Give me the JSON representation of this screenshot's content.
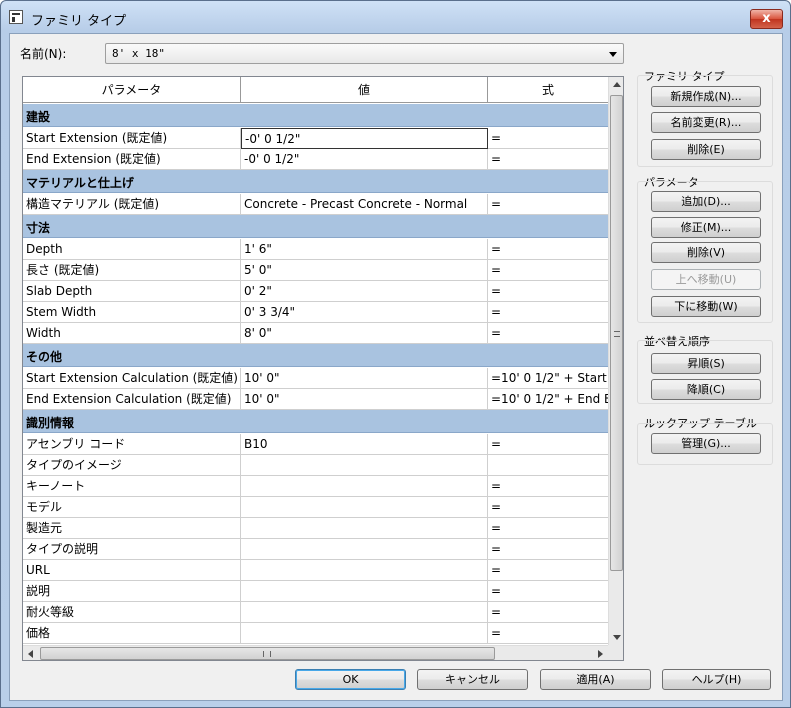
{
  "window": {
    "title": "ファミリ タイプ",
    "close_glyph": "x"
  },
  "name_field": {
    "label": "名前(N):",
    "value": "8' x 18\""
  },
  "grid": {
    "columns": [
      "パラメータ",
      "値",
      "式"
    ],
    "rows": [
      {
        "group": "建設"
      },
      {
        "param": "Start Extension (既定値)",
        "value": "-0'  0 1/2\"",
        "formula": "=",
        "active": true
      },
      {
        "param": "End Extension (既定値)",
        "value": "-0'  0 1/2\"",
        "formula": "="
      },
      {
        "group": "マテリアルと仕上げ"
      },
      {
        "param": "構造マテリアル (既定値)",
        "value": "Concrete - Precast Concrete - Normal",
        "formula": "="
      },
      {
        "group": "寸法"
      },
      {
        "param": "Depth",
        "value": "1'  6\"",
        "formula": "="
      },
      {
        "param": "長さ (既定値)",
        "value": "5'  0\"",
        "formula": "="
      },
      {
        "param": "Slab Depth",
        "value": "0'  2\"",
        "formula": "="
      },
      {
        "param": "Stem Width",
        "value": "0'  3 3/4\"",
        "formula": "="
      },
      {
        "param": "Width",
        "value": "8'  0\"",
        "formula": "="
      },
      {
        "group": "その他"
      },
      {
        "param": "Start Extension Calculation (既定値)",
        "value": "10'  0\"",
        "formula": "=10'  0 1/2\" + Start"
      },
      {
        "param": "End Extension Calculation (既定値)",
        "value": "10'  0\"",
        "formula": "=10'  0 1/2\" + End E"
      },
      {
        "group": "識別情報"
      },
      {
        "param": "アセンブリ コード",
        "value": "B10",
        "formula": "="
      },
      {
        "param": "タイプのイメージ",
        "value": "",
        "formula": ""
      },
      {
        "param": "キーノート",
        "value": "",
        "formula": "="
      },
      {
        "param": "モデル",
        "value": "",
        "formula": "="
      },
      {
        "param": "製造元",
        "value": "",
        "formula": "="
      },
      {
        "param": "タイプの説明",
        "value": "",
        "formula": "="
      },
      {
        "param": "URL",
        "value": "",
        "formula": "="
      },
      {
        "param": "説明",
        "value": "",
        "formula": "="
      },
      {
        "param": "耐火等級",
        "value": "",
        "formula": "="
      },
      {
        "param": "価格",
        "value": "",
        "formula": "="
      }
    ]
  },
  "family_types": {
    "title": "ファミリ タイプ",
    "new": "新規作成(N)...",
    "rename": "名前変更(R)...",
    "delete": "削除(E)"
  },
  "parameters": {
    "title": "パラメータ",
    "add": "追加(D)...",
    "modify": "修正(M)...",
    "remove": "削除(V)",
    "move_up": "上へ移動(U)",
    "move_down": "下に移動(W)"
  },
  "sort_order": {
    "title": "並べ替え順序",
    "ascending": "昇順(S)",
    "descending": "降順(C)"
  },
  "lookup_tables": {
    "title": "ルックアップ テーブル",
    "manage": "管理(G)..."
  },
  "footer": {
    "ok": "OK",
    "cancel": "キャンセル",
    "apply": "適用(A)",
    "help": "ヘルプ(H)"
  }
}
